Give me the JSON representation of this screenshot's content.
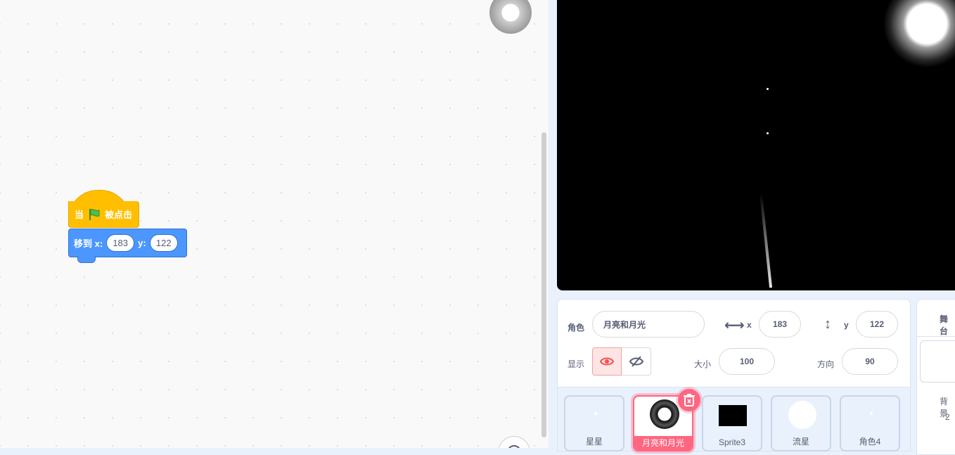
{
  "code": {
    "hat_when": "当",
    "hat_clicked": "被点击",
    "goto_label": "移到 x:",
    "goto_y_label": "y:",
    "goto_x": "183",
    "goto_y": "122"
  },
  "sprite_info": {
    "sprite_label": "角色",
    "sprite_name": "月亮和月光",
    "x_label": "x",
    "x_value": "183",
    "y_label": "y",
    "y_value": "122",
    "show_label": "显示",
    "size_label": "大小",
    "size_value": "100",
    "direction_label": "方向",
    "direction_value": "90"
  },
  "sprites": [
    {
      "name": "星星",
      "selected": false
    },
    {
      "name": "月亮和月光",
      "selected": true
    },
    {
      "name": "Sprite3",
      "selected": false
    },
    {
      "name": "流星",
      "selected": false
    },
    {
      "name": "角色4",
      "selected": false
    }
  ],
  "stage_pane": {
    "title": "舞台",
    "backdrops_label": "背景",
    "backdrops_count": "2"
  },
  "colors": {
    "events": "#ffbf00",
    "motion": "#4c97ff",
    "selected": "#ff6680",
    "stage_bg": "#000000"
  }
}
